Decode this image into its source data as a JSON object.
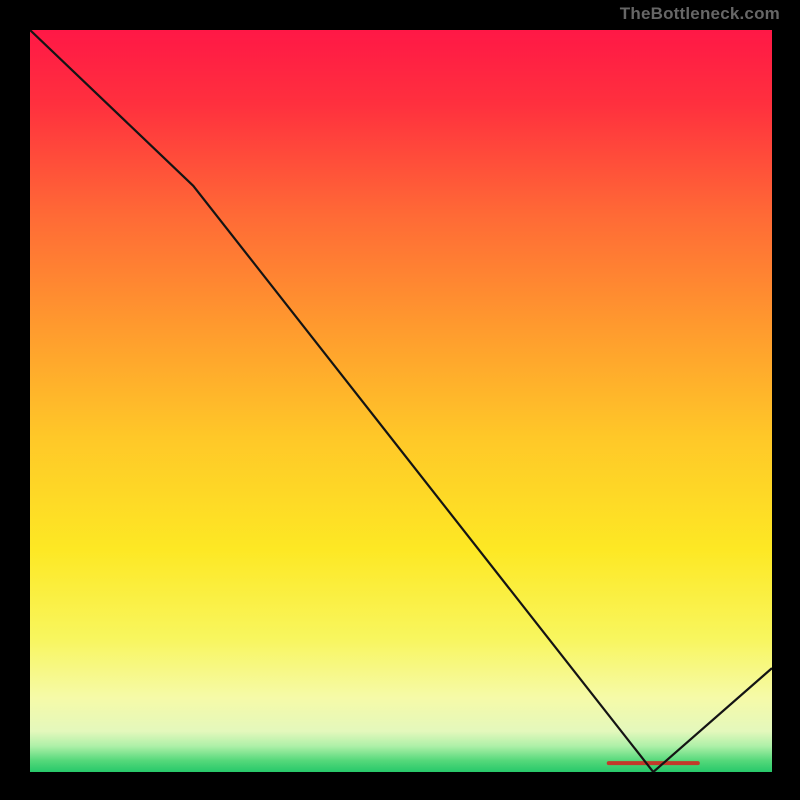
{
  "domain": "Chart",
  "watermark": "TheBottleneck.com",
  "chart_data": {
    "type": "line",
    "title": "",
    "xlabel": "",
    "ylabel": "",
    "xlim": [
      0,
      100
    ],
    "ylim": [
      0,
      100
    ],
    "grid": false,
    "legend": false,
    "x": [
      0,
      22,
      84,
      100
    ],
    "values": [
      100,
      79,
      0,
      14
    ],
    "notes": "Single dark line descending from top-left, slight slope change near x≈22, reaches y=0 around x≈84, then rises into bottom-right corner. Background is a vertical thermal gradient (red→orange→yellow→pale-green→green) inside a black border.",
    "gradient_stops": [
      {
        "offset": 0.0,
        "color": "#ff1846"
      },
      {
        "offset": 0.1,
        "color": "#ff303e"
      },
      {
        "offset": 0.25,
        "color": "#ff6a36"
      },
      {
        "offset": 0.4,
        "color": "#ff9a2e"
      },
      {
        "offset": 0.55,
        "color": "#ffc828"
      },
      {
        "offset": 0.7,
        "color": "#fde824"
      },
      {
        "offset": 0.82,
        "color": "#f8f65e"
      },
      {
        "offset": 0.9,
        "color": "#f6faa8"
      },
      {
        "offset": 0.945,
        "color": "#e4f8bc"
      },
      {
        "offset": 0.965,
        "color": "#aef0a8"
      },
      {
        "offset": 0.985,
        "color": "#54d87a"
      },
      {
        "offset": 1.0,
        "color": "#27c86a"
      }
    ],
    "plateau_marker": {
      "x_start": 78,
      "x_end": 90,
      "y": 1.2,
      "color": "#c23a2a",
      "thickness": 4
    }
  },
  "layout": {
    "outer_size": 800,
    "border_left": 30,
    "border_top": 30,
    "border_right": 28,
    "border_bottom": 28,
    "line_color": "#141414",
    "line_width": 2.2
  }
}
